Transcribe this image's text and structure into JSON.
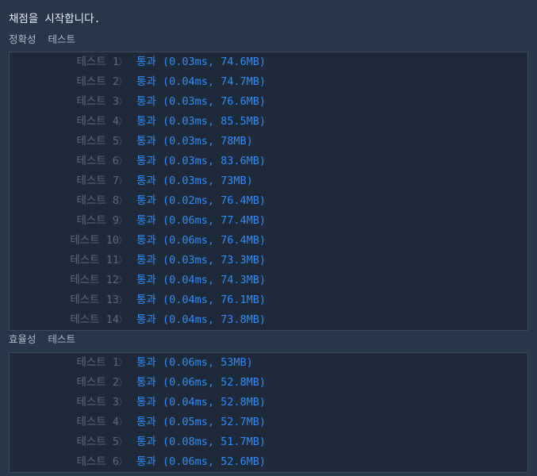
{
  "header": {
    "status_text": "채점을 시작합니다."
  },
  "sections": [
    {
      "title": "정확성  테스트",
      "rows": [
        {
          "label": "테스트 1",
          "result": "통과",
          "detail": "(0.03ms, 74.6MB)"
        },
        {
          "label": "테스트 2",
          "result": "통과",
          "detail": "(0.04ms, 74.7MB)"
        },
        {
          "label": "테스트 3",
          "result": "통과",
          "detail": "(0.03ms, 76.6MB)"
        },
        {
          "label": "테스트 4",
          "result": "통과",
          "detail": "(0.03ms, 85.5MB)"
        },
        {
          "label": "테스트 5",
          "result": "통과",
          "detail": "(0.03ms, 78MB)"
        },
        {
          "label": "테스트 6",
          "result": "통과",
          "detail": "(0.03ms, 83.6MB)"
        },
        {
          "label": "테스트 7",
          "result": "통과",
          "detail": "(0.03ms, 73MB)"
        },
        {
          "label": "테스트 8",
          "result": "통과",
          "detail": "(0.02ms, 76.4MB)"
        },
        {
          "label": "테스트 9",
          "result": "통과",
          "detail": "(0.06ms, 77.4MB)"
        },
        {
          "label": "테스트 10",
          "result": "통과",
          "detail": "(0.06ms, 76.4MB)"
        },
        {
          "label": "테스트 11",
          "result": "통과",
          "detail": "(0.03ms, 73.3MB)"
        },
        {
          "label": "테스트 12",
          "result": "통과",
          "detail": "(0.04ms, 74.3MB)"
        },
        {
          "label": "테스트 13",
          "result": "통과",
          "detail": "(0.04ms, 76.1MB)"
        },
        {
          "label": "테스트 14",
          "result": "통과",
          "detail": "(0.04ms, 73.8MB)"
        }
      ]
    },
    {
      "title": "효율성  테스트",
      "rows": [
        {
          "label": "테스트 1",
          "result": "통과",
          "detail": "(0.06ms, 53MB)"
        },
        {
          "label": "테스트 2",
          "result": "통과",
          "detail": "(0.06ms, 52.8MB)"
        },
        {
          "label": "테스트 3",
          "result": "통과",
          "detail": "(0.04ms, 52.8MB)"
        },
        {
          "label": "테스트 4",
          "result": "통과",
          "detail": "(0.05ms, 52.7MB)"
        },
        {
          "label": "테스트 5",
          "result": "통과",
          "detail": "(0.08ms, 51.7MB)"
        },
        {
          "label": "테스트 6",
          "result": "통과",
          "detail": "(0.06ms, 52.6MB)"
        }
      ]
    }
  ],
  "colors": {
    "background": "#263747",
    "box_background": "#1e2a38",
    "pass_blue": "#2f8cff",
    "muted_label": "#5d6b79"
  }
}
